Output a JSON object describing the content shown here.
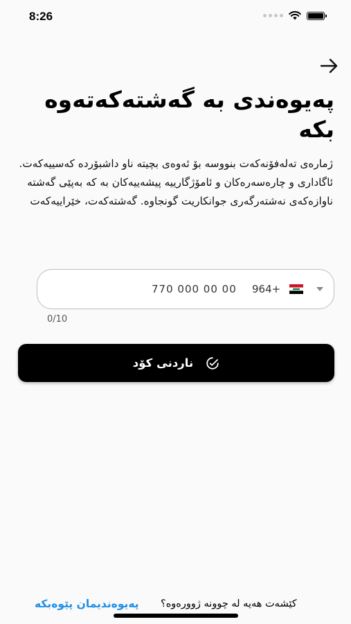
{
  "status_bar": {
    "time": "8:26"
  },
  "title": "پەیوەندی بە گەشتەکەتەوە بکە",
  "description": "ژمارەی تەلەفۆنەکەت بنووسە بۆ ئەوەی بچیتە ناو داشبۆردە کەسییەکەت. ئاگاداری و چارەسەرەکان و ئامۆژگارییە پیشەییەکان بە کە بەپێی گەشتە ناوازەکەی نەشتەرگەری جوانکاریت گونجاوە. گەشتەکەت، خێراییەکەت",
  "phone_field": {
    "flag_icon": "iraq-flag-icon",
    "dial_code": "964+",
    "placeholder": "770 000 00 00"
  },
  "char_counter": "0/10",
  "send_button": {
    "label": "ناردنی کۆد",
    "icon": "check-circle-icon"
  },
  "footer": {
    "question": "کێشەت هەیە لە چوونە ژوورەوە؟",
    "link": "پەیوەندیمان پێوەبکە"
  },
  "colors": {
    "accent_link": "#1f8ee6",
    "button_bg": "#000000",
    "background": "#fafafa"
  }
}
